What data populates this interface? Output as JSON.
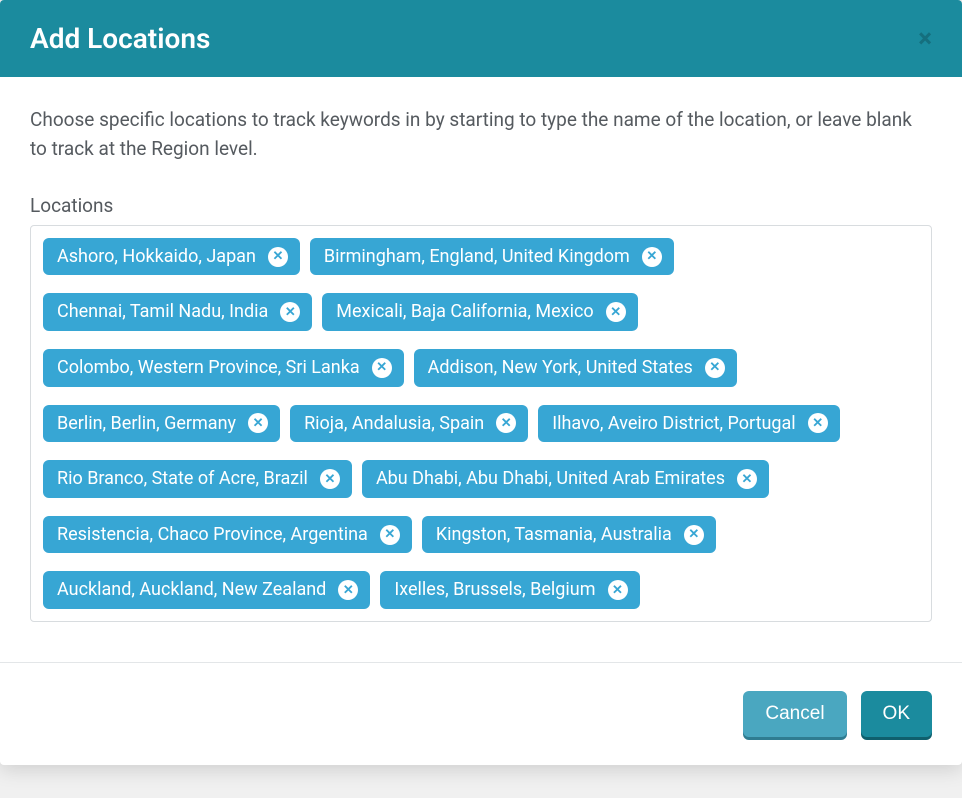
{
  "modal": {
    "title": "Add Locations",
    "closeGlyph": "×",
    "description": "Choose specific locations to track keywords in by starting to type the name of the location, or leave blank to track at the Region level.",
    "fieldLabel": "Locations",
    "chipRemoveGlyph": "✕",
    "locations": [
      "Ashoro, Hokkaido, Japan",
      "Birmingham, England, United Kingdom",
      "Chennai, Tamil Nadu, India",
      "Mexicali, Baja California, Mexico",
      "Colombo, Western Province, Sri Lanka",
      "Addison, New York, United States",
      "Berlin, Berlin, Germany",
      "Rioja, Andalusia, Spain",
      "Ilhavo, Aveiro District, Portugal",
      "Rio Branco, State of Acre, Brazil",
      "Abu Dhabi, Abu Dhabi, United Arab Emirates",
      "Resistencia, Chaco Province, Argentina",
      "Kingston, Tasmania, Australia",
      "Auckland, Auckland, New Zealand",
      "Ixelles, Brussels, Belgium"
    ],
    "footer": {
      "cancel": "Cancel",
      "ok": "OK"
    }
  }
}
